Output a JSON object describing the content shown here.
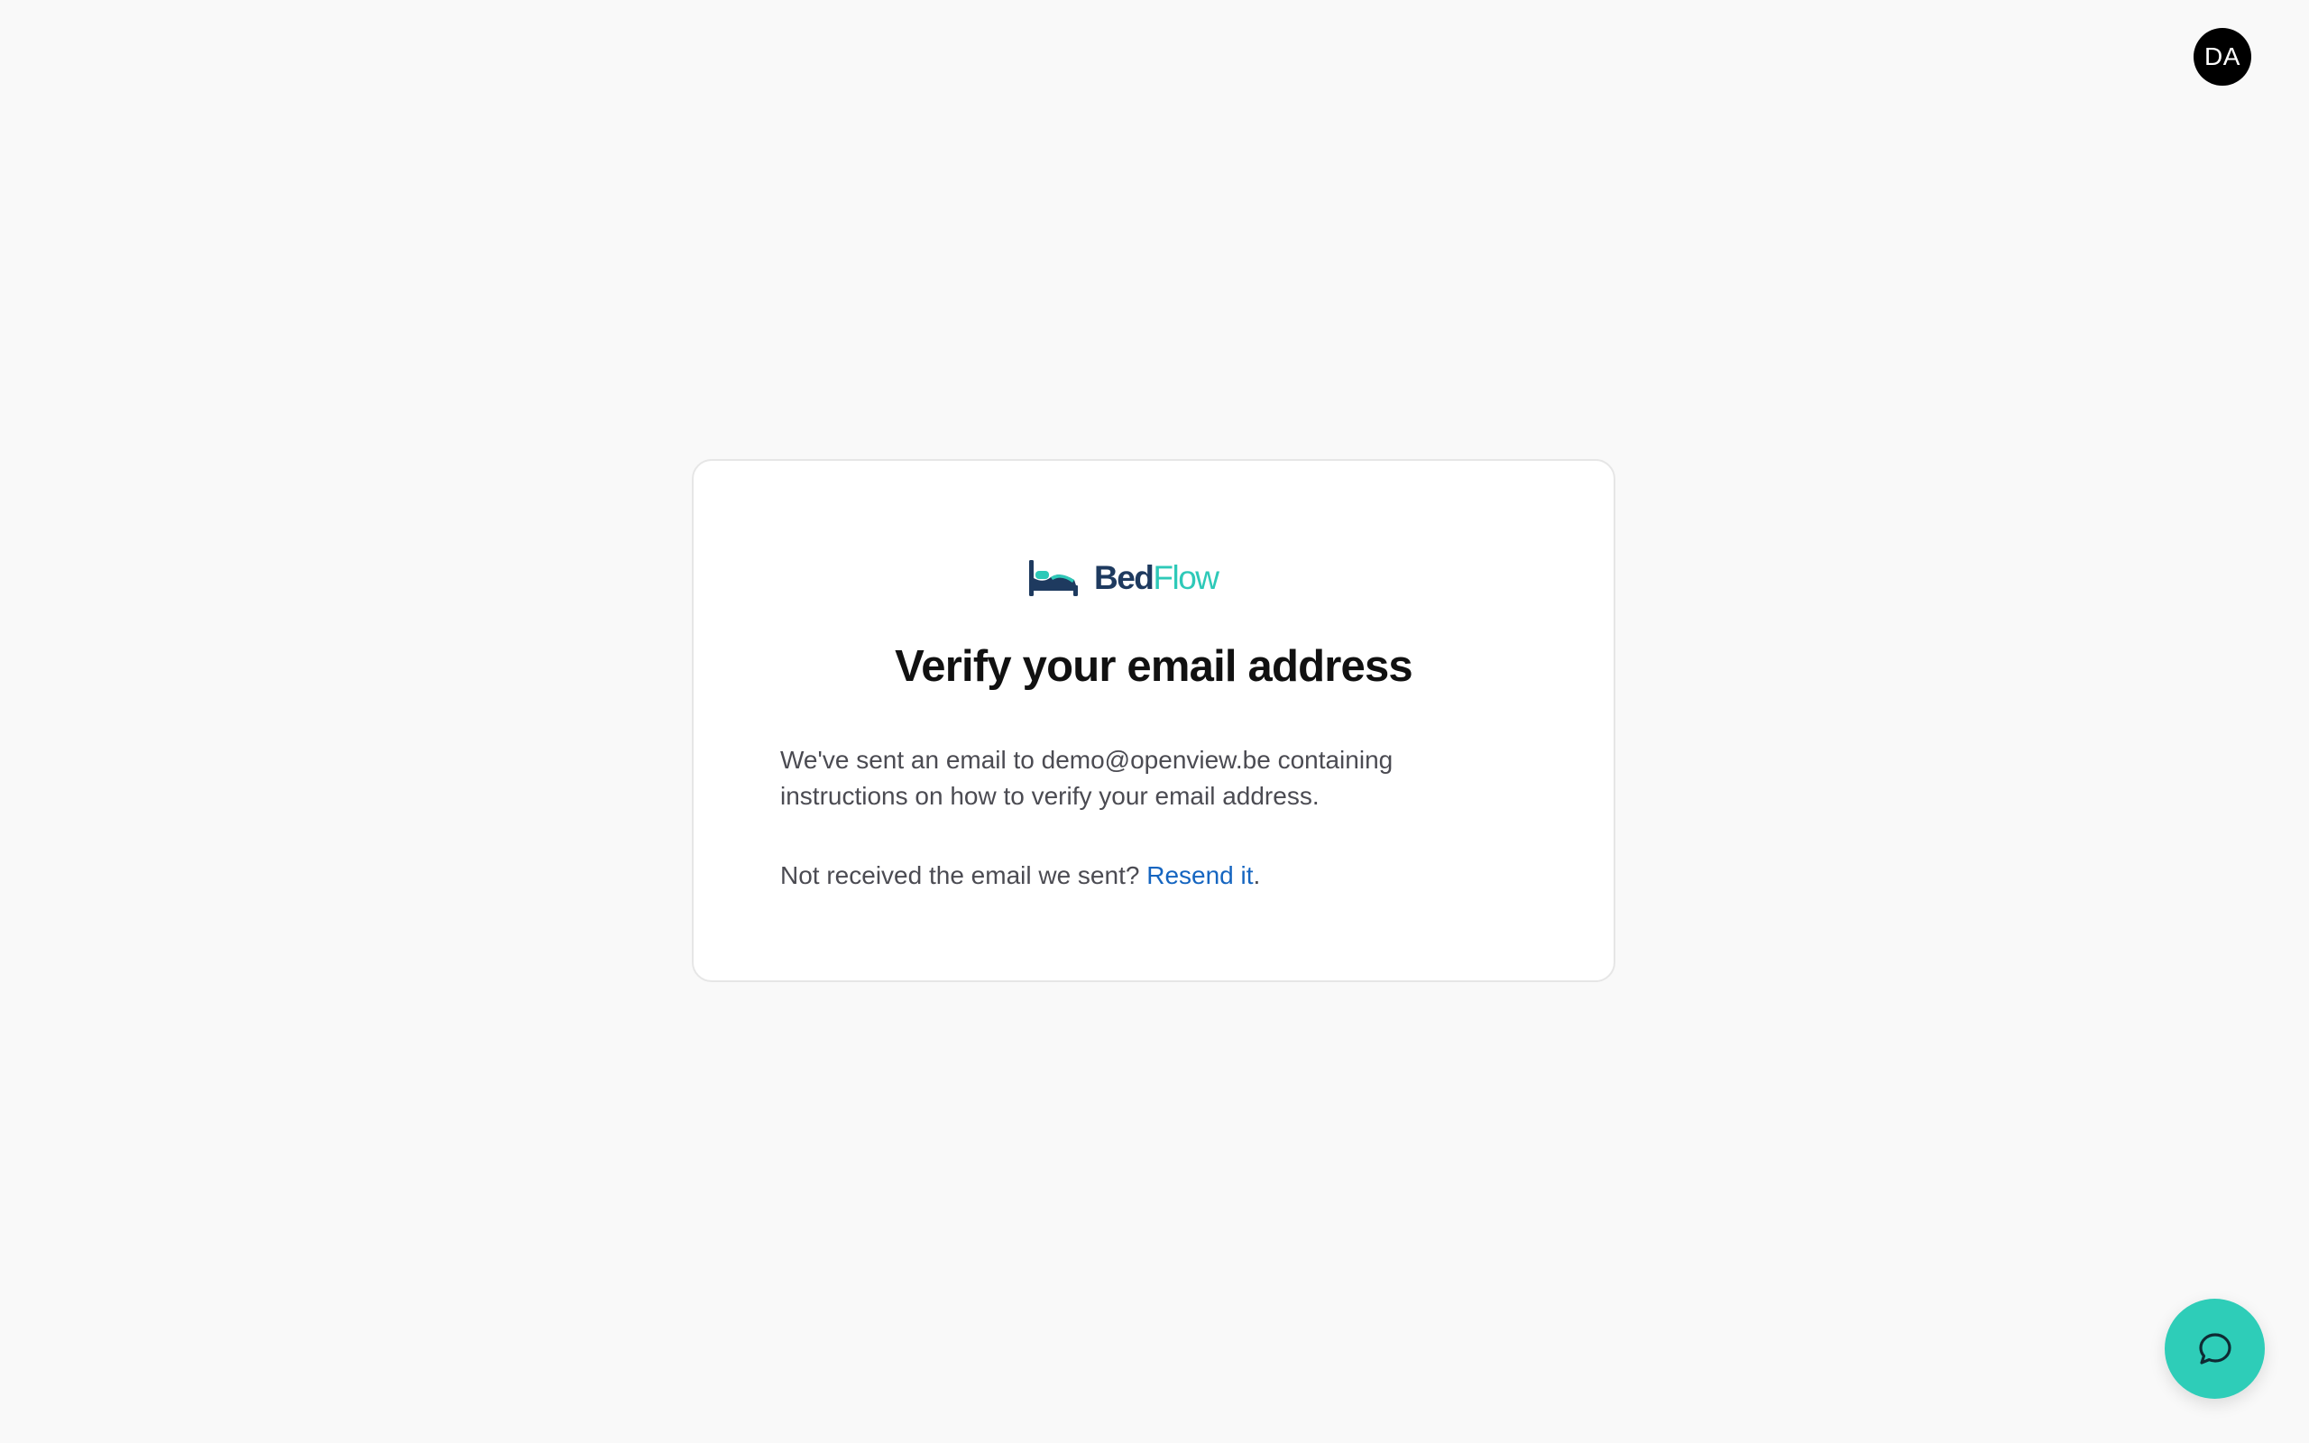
{
  "header": {
    "avatar_initials": "DA"
  },
  "brand": {
    "name_part1": "Bed",
    "name_part2": "Flow",
    "icon": "bed-icon",
    "colors": {
      "primary": "#1e3a5f",
      "accent": "#2ec9b8"
    }
  },
  "verify": {
    "title": "Verify your email address",
    "message": "We've sent an email to demo@openview.be containing instructions on how to verify your email address.",
    "resend_prefix": "Not received the email we sent? ",
    "resend_link": "Resend it",
    "resend_suffix": "."
  },
  "chat": {
    "icon": "chat-bubble-icon",
    "color": "#2ecdb8"
  }
}
